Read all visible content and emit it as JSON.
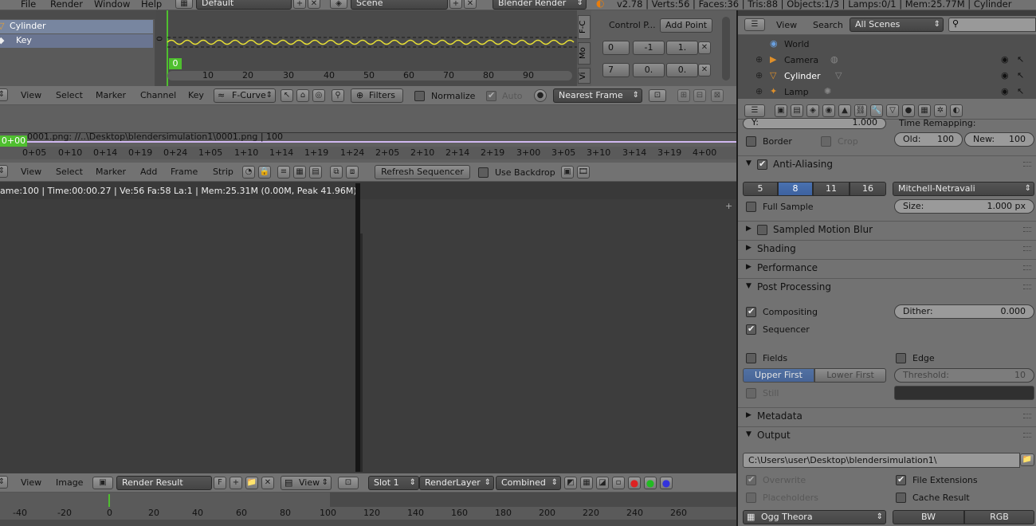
{
  "top_bar": {
    "menus": [
      "File",
      "Render",
      "Window",
      "Help"
    ],
    "layout": "Default",
    "scene": "Scene",
    "engine": "Blender Render",
    "stats": "v2.78 | Verts:56 | Faces:36 | Tris:88 | Objects:1/3 | Lamps:0/1 | Mem:25.77M | Cylinder"
  },
  "graph_editor": {
    "channels": [
      "Cylinder",
      "Key"
    ],
    "frame_marker": "0",
    "y_label": "0",
    "ruler": [
      "10",
      "20",
      "30",
      "40",
      "50",
      "60",
      "70",
      "80",
      "90"
    ],
    "side_tabs": [
      "F-C",
      "Mo",
      "Vi"
    ],
    "control_points_label": "Control P...",
    "add_point": "Add Point",
    "row1": [
      "0",
      "-1",
      "1."
    ],
    "row2": [
      "7",
      "0.",
      "0."
    ],
    "menus": [
      "View",
      "Select",
      "Marker",
      "Channel",
      "Key"
    ],
    "mode": "F-Curve",
    "filters": "Filters",
    "normalize": "Normalize",
    "auto": "Auto",
    "snap": "Nearest Frame"
  },
  "sequencer": {
    "strip_label": "0001.png: //..\\Desktop\\blendersimulation1\\0001.png | 100",
    "current_frame": "0+00",
    "ruler": [
      "0+05",
      "0+10",
      "0+14",
      "0+19",
      "0+24",
      "1+05",
      "1+10",
      "1+14",
      "1+19",
      "1+24",
      "2+05",
      "2+10",
      "2+14",
      "2+19",
      "3+00",
      "3+05",
      "3+10",
      "3+14",
      "3+19",
      "4+00"
    ],
    "menus": [
      "View",
      "Select",
      "Marker",
      "Add",
      "Frame",
      "Strip"
    ],
    "refresh": "Refresh Sequencer",
    "use_backdrop": "Use Backdrop"
  },
  "image_editor": {
    "info": "ame:100 | Time:00:00.27 | Ve:56 Fa:58 La:1 | Mem:25.31M (0.00M, Peak 41.96M)",
    "menus": [
      "View",
      "Image"
    ],
    "image_name": "Render Result",
    "fake_user": "F",
    "view": "View",
    "slot": "Slot 1",
    "layer": "RenderLayer",
    "pass": "Combined",
    "ruler": [
      "-40",
      "-20",
      "0",
      "20",
      "40",
      "60",
      "80",
      "100",
      "120",
      "140",
      "160",
      "180",
      "200",
      "220",
      "240",
      "260"
    ]
  },
  "outliner": {
    "menus": [
      "View",
      "Search"
    ],
    "scenes": "All Scenes",
    "items": [
      "World",
      "Camera",
      "Cylinder",
      "Lamp"
    ]
  },
  "properties": {
    "y_field": "Y:",
    "y_value": "1.000",
    "time_remapping": "Time Remapping:",
    "border": "Border",
    "crop": "Crop",
    "old_label": "Old:",
    "old_value": "100",
    "new_label": "New:",
    "new_value": "100",
    "anti_aliasing": "Anti-Aliasing",
    "aa_samples": [
      "5",
      "8",
      "11",
      "16"
    ],
    "aa_filter": "Mitchell-Netravali",
    "full_sample": "Full Sample",
    "size_label": "Size:",
    "size_value": "1.000 px",
    "sections": [
      "Sampled Motion Blur",
      "Shading",
      "Performance",
      "Post Processing",
      "Metadata",
      "Output"
    ],
    "compositing": "Compositing",
    "sequencer": "Sequencer",
    "dither_label": "Dither:",
    "dither_value": "0.000",
    "fields": "Fields",
    "edge": "Edge",
    "upper_first": "Upper First",
    "lower_first": "Lower First",
    "threshold_label": "Threshold:",
    "threshold_value": "10",
    "still": "Still",
    "output_path": "C:\\Users\\user\\Desktop\\blendersimulation1\\",
    "overwrite": "Overwrite",
    "file_extensions": "File Extensions",
    "placeholders": "Placeholders",
    "cache_result": "Cache Result",
    "format": "Ogg Theora",
    "bw": "BW",
    "rgb": "RGB"
  }
}
